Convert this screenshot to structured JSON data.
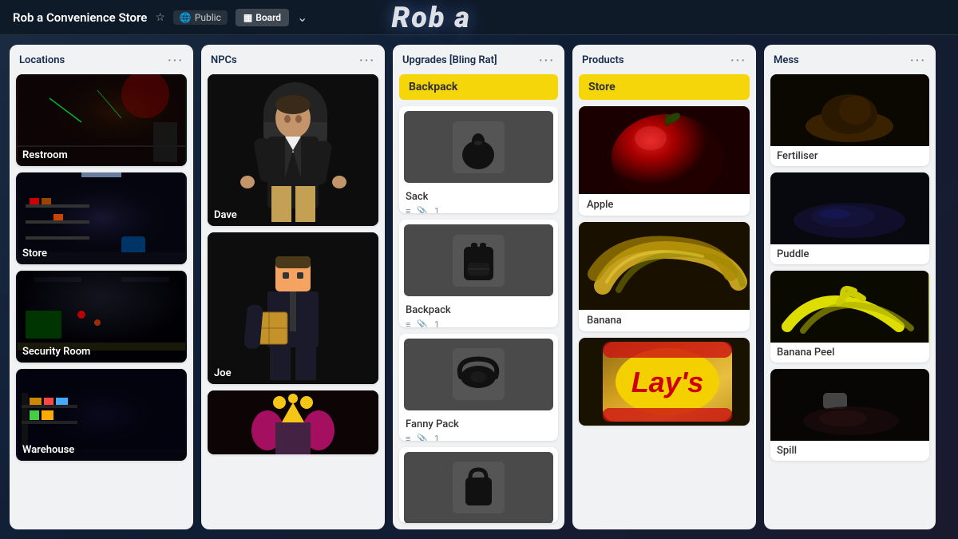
{
  "header": {
    "title": "Rob a Convenience Store",
    "bg_text": "Rob a",
    "visibility": "Public",
    "view": "Board",
    "star_symbol": "☆",
    "globe_symbol": "🌐",
    "board_symbol": "▦",
    "chevron_symbol": "⌄",
    "dots_symbol": "···"
  },
  "columns": {
    "locations": {
      "label": "Locations",
      "cards": [
        {
          "name": "Restroom"
        },
        {
          "name": "Store"
        },
        {
          "name": "Security Room"
        },
        {
          "name": "Warehouse"
        }
      ]
    },
    "npcs": {
      "label": "NPCs",
      "cards": [
        {
          "name": "Dave"
        },
        {
          "name": "Joe"
        },
        {
          "name": ""
        }
      ]
    },
    "upgrades": {
      "label": "Upgrades [Bling Rat]",
      "section": "Backpack",
      "items": [
        {
          "name": "Sack",
          "desc_count": "1"
        },
        {
          "name": "Backpack",
          "desc_count": "1"
        },
        {
          "name": "Fanny Pack",
          "desc_count": "1"
        },
        {
          "name": ""
        }
      ]
    },
    "products": {
      "label": "Products",
      "section": "Store",
      "items": [
        {
          "name": "Apple"
        },
        {
          "name": "Banana"
        },
        {
          "name": "Lays"
        }
      ]
    },
    "mess": {
      "label": "Mess",
      "items": [
        {
          "name": "Fertiliser"
        },
        {
          "name": "Puddle"
        },
        {
          "name": "Banana Peel"
        },
        {
          "name": "Spill"
        }
      ]
    }
  },
  "icons": {
    "list": "≡",
    "clip": "📎",
    "dots": "···"
  }
}
